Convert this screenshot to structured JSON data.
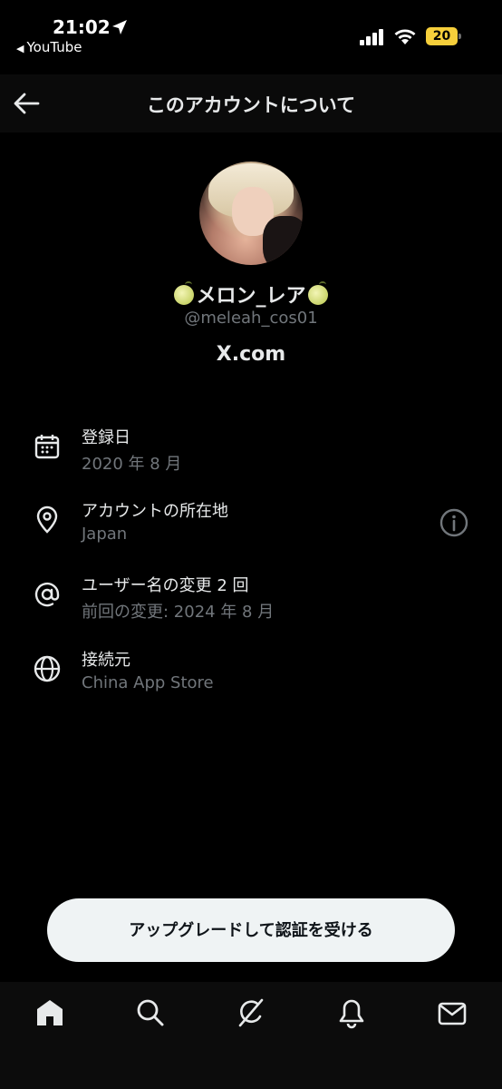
{
  "status_bar": {
    "time": "21:02",
    "back_app": "YouTube",
    "battery": "20",
    "battery_color": "#f6cf3b"
  },
  "header": {
    "title": "このアカウントについて"
  },
  "profile": {
    "display_name": "メロン_レア",
    "handle": "@meleah_cos01",
    "site": "X.com"
  },
  "info": [
    {
      "label": "登録日",
      "value": "2020 年 8 月",
      "icon": "calendar-icon"
    },
    {
      "label": "アカウントの所在地",
      "value": "Japan",
      "icon": "location-pin-icon"
    },
    {
      "label": "ユーザー名の変更 2 回",
      "value": "前回の変更: 2024 年 8 月",
      "icon": "at-sign-icon"
    },
    {
      "label": "接続元",
      "value": "China App Store",
      "icon": "globe-icon"
    }
  ],
  "cta": {
    "label": "アップグレードして認証を受ける"
  },
  "nav": [
    "home-icon",
    "search-icon",
    "grok-icon",
    "notifications-icon",
    "messages-icon"
  ],
  "colors": {
    "background": "#000000",
    "primary_text": "#e7e9ea",
    "secondary_text": "#71767b",
    "cta_background": "#eff3f4"
  }
}
